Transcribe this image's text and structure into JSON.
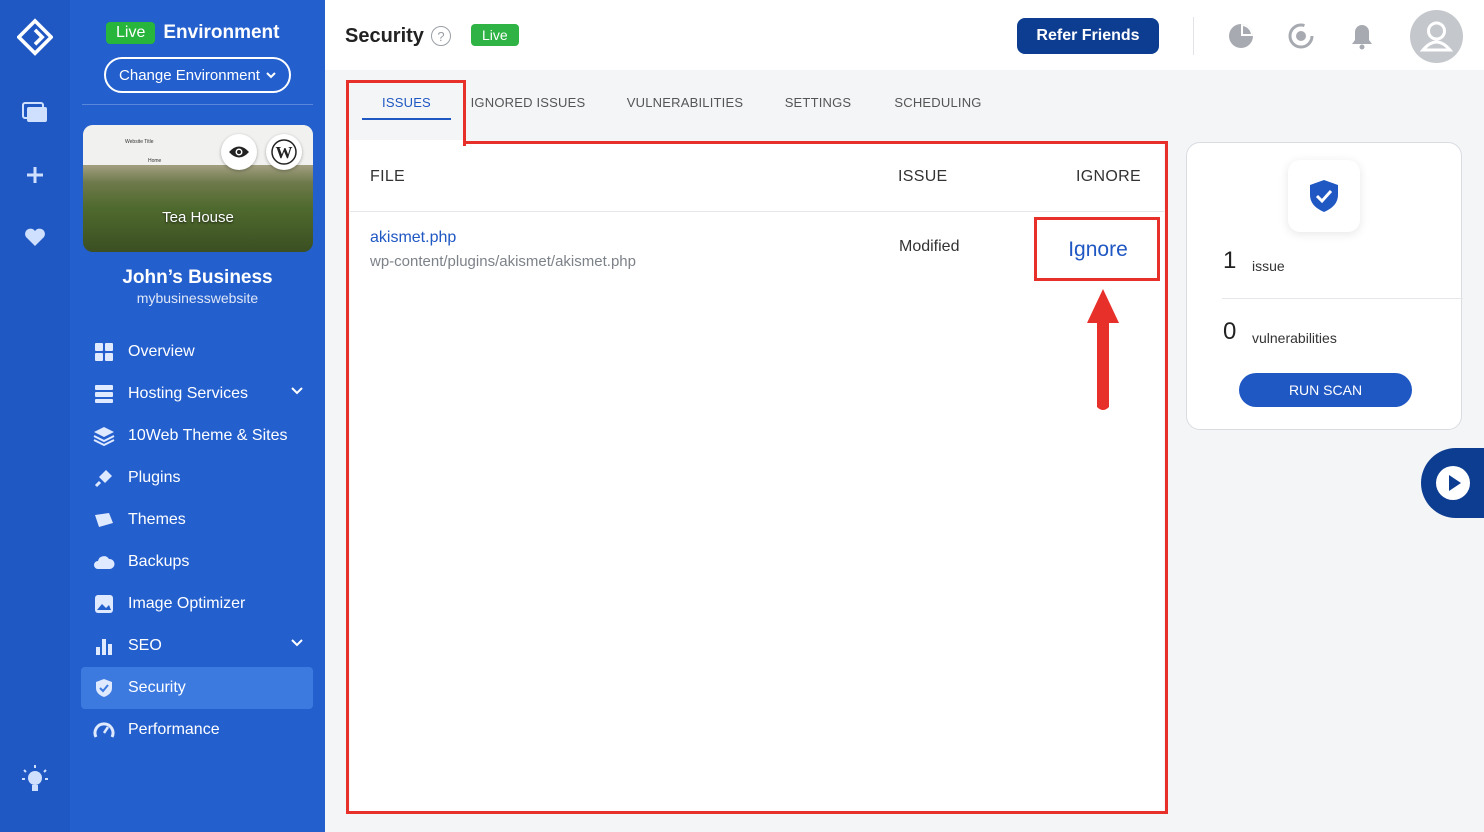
{
  "sidebar": {
    "env_badge": "Live",
    "env_label": "Environment",
    "change_env_label": "Change Environment",
    "site_thumb_title": "Tea House",
    "site_thumb_heading": "Website Title",
    "site_thumb_nav": "Home",
    "site_name": "John’s Business",
    "site_url": "mybusinesswebsite",
    "nav": [
      {
        "label": "Overview",
        "icon": "grid-icon"
      },
      {
        "label": "Hosting Services",
        "icon": "server-icon",
        "expandable": true
      },
      {
        "label": "10Web Theme & Sites",
        "icon": "layers-icon"
      },
      {
        "label": "Plugins",
        "icon": "plug-icon"
      },
      {
        "label": "Themes",
        "icon": "brush-icon"
      },
      {
        "label": "Backups",
        "icon": "cloud-icon"
      },
      {
        "label": "Image Optimizer",
        "icon": "image-icon"
      },
      {
        "label": "SEO",
        "icon": "bar-chart-icon",
        "expandable": true
      },
      {
        "label": "Security",
        "icon": "shield-icon",
        "active": true
      },
      {
        "label": "Performance",
        "icon": "gauge-icon"
      }
    ]
  },
  "header": {
    "title": "Security",
    "live_badge": "Live",
    "refer_label": "Refer Friends"
  },
  "tabs": [
    "ISSUES",
    "IGNORED ISSUES",
    "VULNERABILITIES",
    "SETTINGS",
    "SCHEDULING"
  ],
  "table": {
    "columns": [
      "FILE",
      "ISSUE",
      "IGNORE"
    ],
    "rows": [
      {
        "file": "akismet.php",
        "path": "wp-content/plugins/akismet/akismet.php",
        "issue": "Modified",
        "action": "Ignore"
      }
    ]
  },
  "stats": {
    "issues_count": "1",
    "issues_label": "issue",
    "vuln_count": "0",
    "vuln_label": "vulnerabilities",
    "run_scan_label": "RUN SCAN"
  },
  "colors": {
    "sidebar": "#235fcd",
    "rail": "#1f57c3",
    "accent": "#1f57c3",
    "dark_button": "#0d3d91",
    "live_green": "#2fb344",
    "highlight": "#e8302a"
  }
}
